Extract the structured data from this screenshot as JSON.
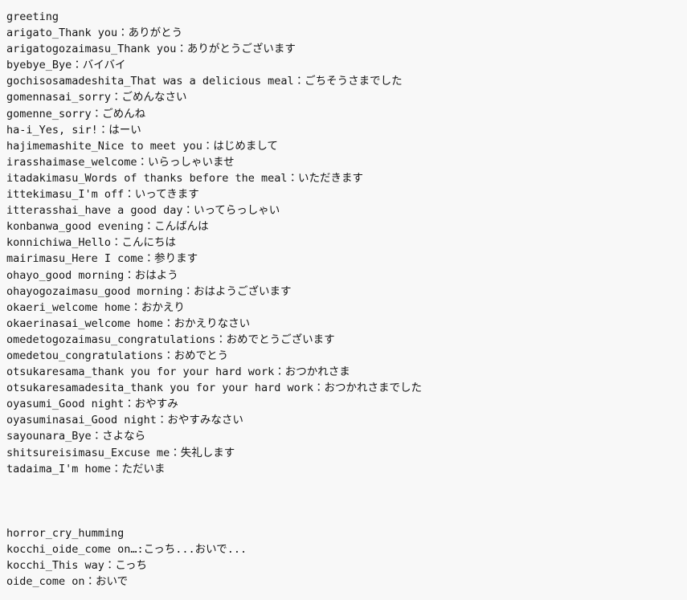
{
  "document": {
    "background_color": "#f8f8f8",
    "text_color": "#151515",
    "sections": [
      {
        "heading": "greeting",
        "lines": [
          "arigato_Thank you：ありがとう",
          "arigatogozaimasu_Thank you：ありがとうございます",
          "byebye_Bye：バイバイ",
          "gochisosamadeshita_That was a delicious meal：ごちそうさまでした",
          "gomennasai_sorry：ごめんなさい",
          "gomenne_sorry：ごめんね",
          "ha-i_Yes, sir!：はーい",
          "hajimemashite_Nice to meet you：はじめまして",
          "irasshaimase_welcome：いらっしゃいませ",
          "itadakimasu_Words of thanks before the meal：いただきます",
          "ittekimasu_I'm off：いってきます",
          "itterasshai_have a good day：いってらっしゃい",
          "konbanwa_good evening：こんばんは",
          "konnichiwa_Hello：こんにちは",
          "mairimasu_Here I come：参ります",
          "ohayo_good morning：おはよう",
          "ohayogozaimasu_good morning：おはようございます",
          "okaeri_welcome home：おかえり",
          "okaerinasai_welcome home：おかえりなさい",
          "omedetogozaimasu_congratulations：おめでとうございます",
          "omedetou_congratulations：おめでとう",
          "otsukaresama_thank you for your hard work：おつかれさま",
          "otsukaresamadesita_thank you for your hard work：おつかれさまでした",
          "oyasumi_Good night：おやすみ",
          "oyasuminasai_Good night：おやすみなさい",
          "sayounara_Bye：さよなら",
          "shitsureisimasu_Excuse me：失礼します",
          "tadaima_I'm home：ただいま"
        ]
      },
      {
        "heading": "horror_cry_humming",
        "lines": [
          "kocchi_oide_come on…:こっち...おいで...",
          "kocchi_This way：こっち",
          "oide_come on：おいで"
        ]
      }
    ]
  }
}
